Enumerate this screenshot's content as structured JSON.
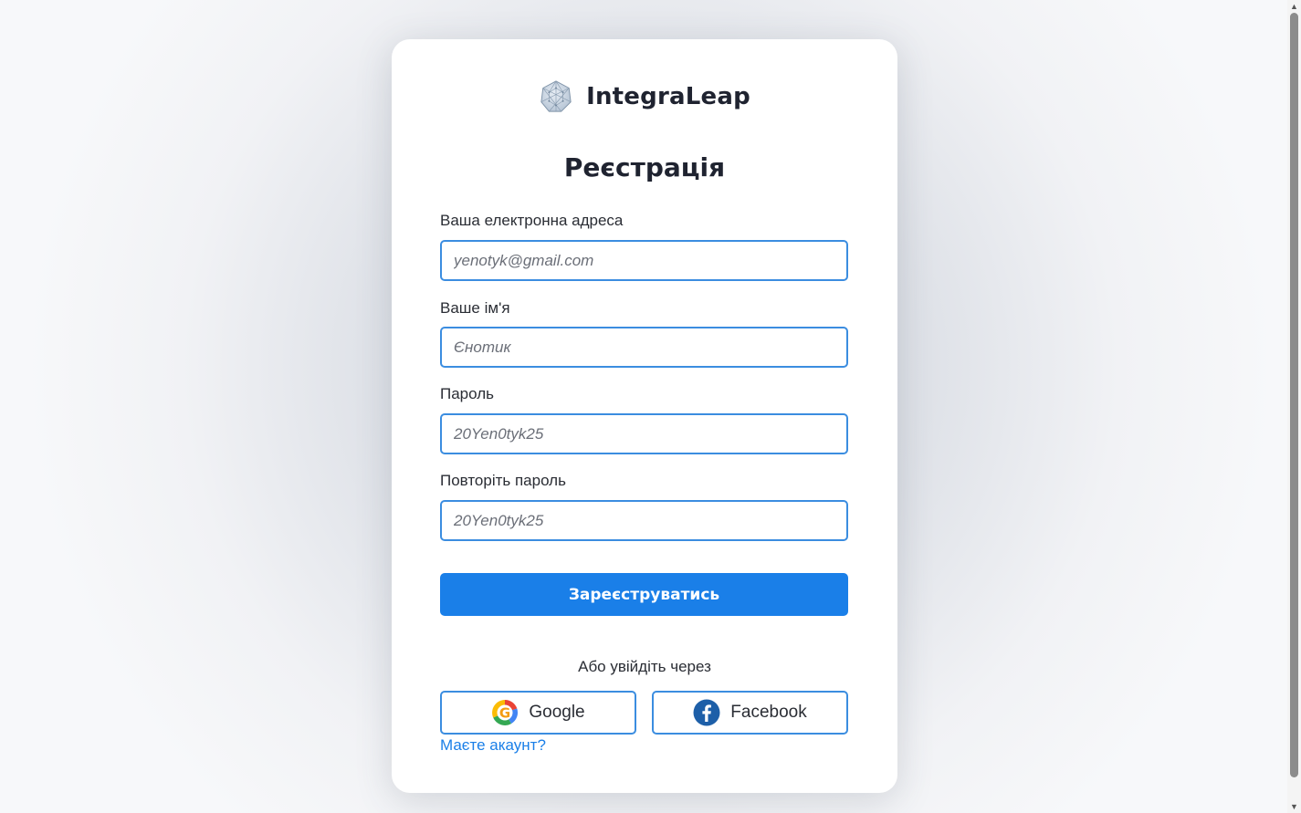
{
  "brand": {
    "name": "IntegraLeap",
    "logo_icon": "geodesic-sphere-icon"
  },
  "form": {
    "title": "Реєстрація",
    "fields": [
      {
        "label": "Ваша електронна адреса",
        "placeholder": "yenotyk@gmail.com",
        "type": "email"
      },
      {
        "label": "Ваше ім'я",
        "placeholder": "Єнотик",
        "type": "text"
      },
      {
        "label": "Пароль",
        "placeholder": "20Yen0tyk25",
        "type": "password"
      },
      {
        "label": "Повторіть пароль",
        "placeholder": "20Yen0tyk25",
        "type": "password"
      }
    ],
    "submit_label": "Зареєструватись",
    "or_text": "Або увійдіть через",
    "google_label": "Google",
    "facebook_label": "Facebook",
    "login_link": "Маєте акаунт?"
  },
  "colors": {
    "accent": "#1a7fe8",
    "input_border": "#3b8de0",
    "text": "#1f2330"
  }
}
